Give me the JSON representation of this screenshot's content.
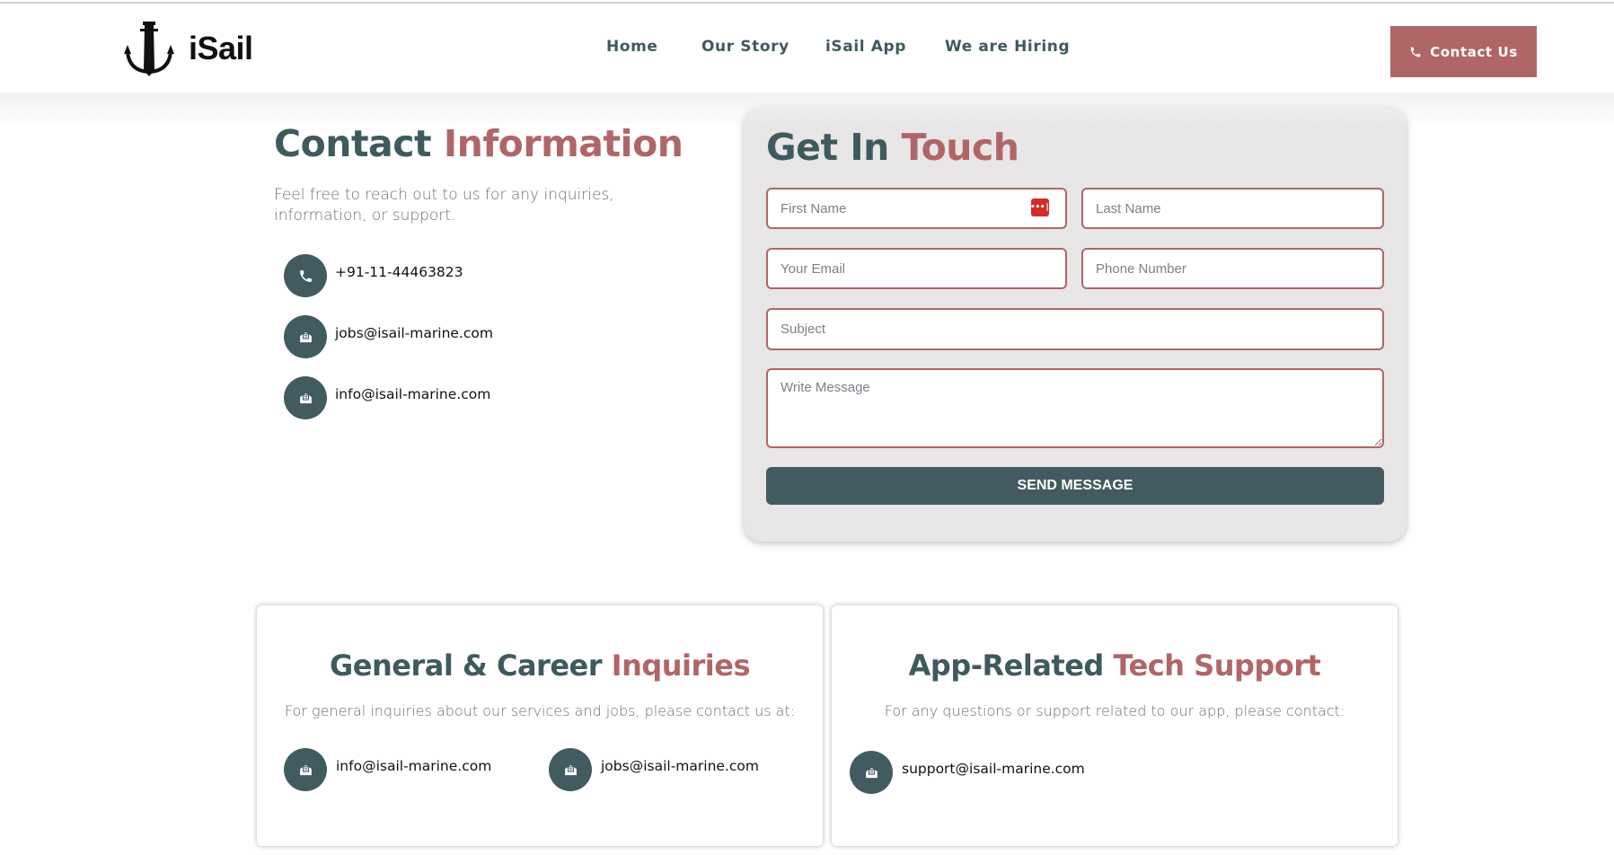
{
  "brand": {
    "name": "iSail",
    "logo_icon": "anchor-icon"
  },
  "nav": {
    "items": [
      {
        "label": "Home"
      },
      {
        "label": "Our Story"
      },
      {
        "label": "iSail App"
      },
      {
        "label": "We are Hiring"
      }
    ],
    "cta": {
      "label": "Contact Us",
      "icon": "phone-icon"
    }
  },
  "contact_info": {
    "title_main": "Contact",
    "title_accent": "Information",
    "description": "Feel free to reach out to us for any inquiries, information, or support.",
    "items": [
      {
        "icon": "phone-icon",
        "text": "+91-11-44463823"
      },
      {
        "icon": "envelope-open-text-icon",
        "text": "jobs@isail-marine.com"
      },
      {
        "icon": "envelope-open-text-icon",
        "text": "info@isail-marine.com"
      }
    ]
  },
  "form": {
    "title_main": "Get In",
    "title_accent": "Touch",
    "fields": {
      "first_name": {
        "placeholder": "First Name",
        "value": ""
      },
      "last_name": {
        "placeholder": "Last Name",
        "value": ""
      },
      "email": {
        "placeholder": "Your Email",
        "value": ""
      },
      "phone": {
        "placeholder": "Phone Number",
        "value": ""
      },
      "subject": {
        "placeholder": "Subject",
        "value": ""
      },
      "message": {
        "placeholder": "Write Message",
        "value": ""
      }
    },
    "password_manager_icon": "•••|",
    "submit_label": "SEND MESSAGE"
  },
  "cards": {
    "general": {
      "title_main": "General & Career",
      "title_accent": "Inquiries",
      "description": "For general inquiries about our services and jobs, please contact us at:",
      "items": [
        {
          "icon": "envelope-open-text-icon",
          "text": "info@isail-marine.com"
        },
        {
          "icon": "envelope-open-text-icon",
          "text": "jobs@isail-marine.com"
        }
      ]
    },
    "tech": {
      "title_main": "App-Related",
      "title_accent": "Tech Support",
      "description": "For any questions or support related to our app, please contact:",
      "items": [
        {
          "icon": "envelope-open-text-icon",
          "text": "support@isail-marine.com"
        }
      ]
    }
  },
  "colors": {
    "primary": "#425b60",
    "accent": "#b06667",
    "form_bg": "#e8e6e7",
    "password_manager": "#d32d27"
  }
}
